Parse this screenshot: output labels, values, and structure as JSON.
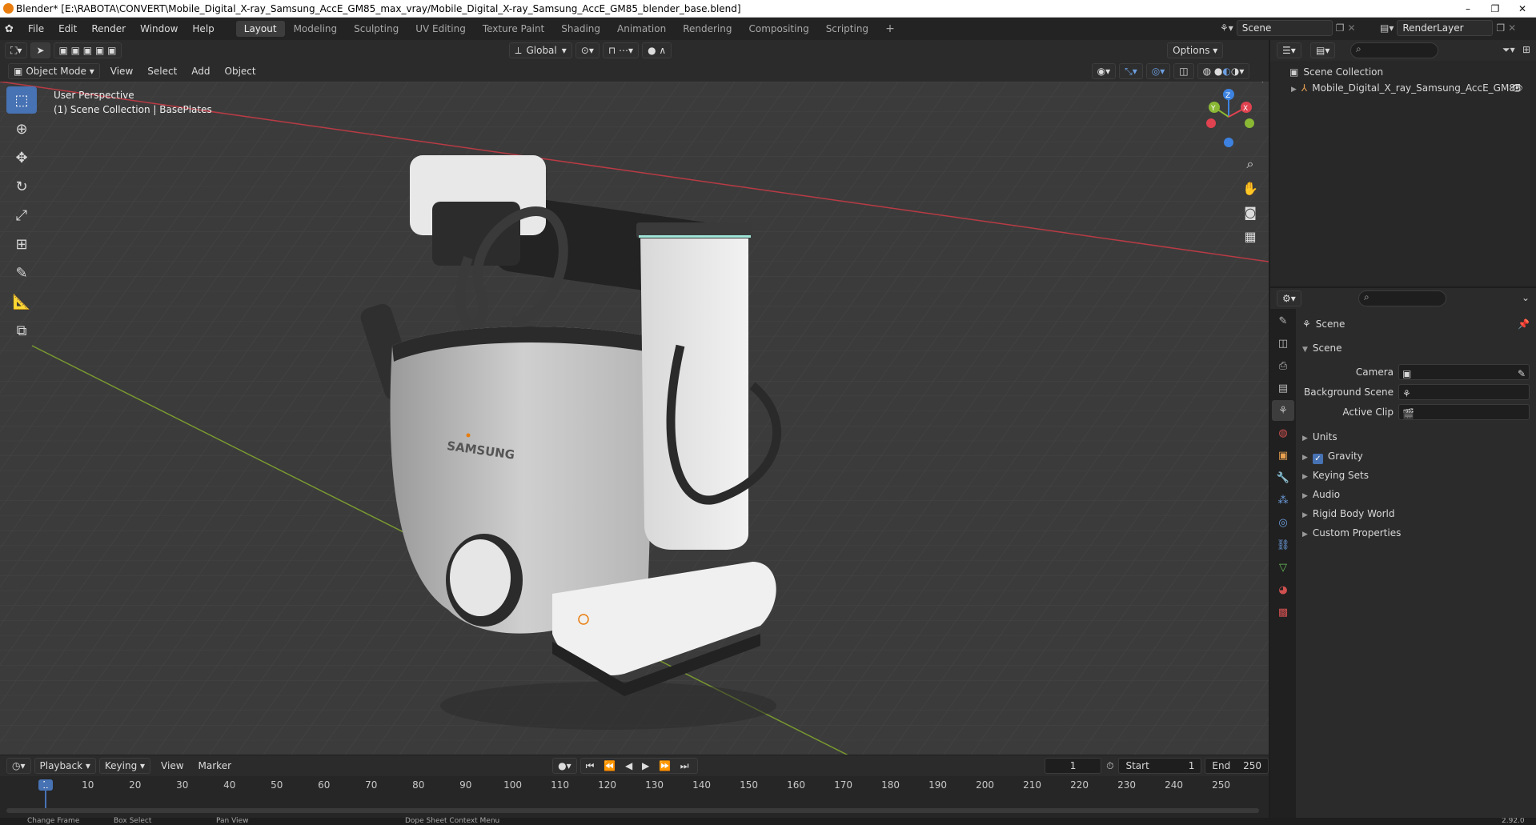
{
  "window": {
    "title": "Blender* [E:\\RABOTA\\CONVERT\\Mobile_Digital_X-ray_Samsung_AccE_GM85_max_vray/Mobile_Digital_X-ray_Samsung_AccE_GM85_blender_base.blend]",
    "buttons": [
      "–",
      "❐",
      "✕"
    ]
  },
  "menu": [
    "File",
    "Edit",
    "Render",
    "Window",
    "Help"
  ],
  "workspaces": [
    "Layout",
    "Modeling",
    "Sculpting",
    "UV Editing",
    "Texture Paint",
    "Shading",
    "Animation",
    "Rendering",
    "Compositing",
    "Scripting"
  ],
  "workspace_add": "+",
  "active_workspace": "Layout",
  "scene_name": "Scene",
  "view_layer": "RenderLayer",
  "viewport_header": {
    "transform_orientation": "Global",
    "options_label": "Options",
    "mode": "Object Mode",
    "menus": [
      "View",
      "Select",
      "Add",
      "Object"
    ]
  },
  "viewport_overlay": {
    "perspective": "User Perspective",
    "collection_info": "(1) Scene Collection | BasePlates"
  },
  "gizmo_axes": {
    "z": "Z",
    "y": "Y",
    "x": "X"
  },
  "outliner": {
    "root": "Scene Collection",
    "items": [
      "Mobile_Digital_X_ray_Samsung_AccE_GM85"
    ]
  },
  "properties": {
    "context": "Scene",
    "panel_title": "Scene",
    "fields": [
      {
        "label": "Camera",
        "value": ""
      },
      {
        "label": "Background Scene",
        "value": ""
      },
      {
        "label": "Active Clip",
        "value": ""
      }
    ],
    "sections": [
      {
        "label": "Units",
        "checkbox": false
      },
      {
        "label": "Gravity",
        "checkbox": true
      },
      {
        "label": "Keying Sets",
        "checkbox": false
      },
      {
        "label": "Audio",
        "checkbox": false
      },
      {
        "label": "Rigid Body World",
        "checkbox": false
      },
      {
        "label": "Custom Properties",
        "checkbox": false
      }
    ]
  },
  "timeline": {
    "menus": [
      "Playback",
      "Keying",
      "View",
      "Marker"
    ],
    "current_frame": "1",
    "start_label": "Start",
    "start": "1",
    "end_label": "End",
    "end": "250",
    "ruler": [
      "1",
      "10",
      "20",
      "30",
      "40",
      "50",
      "60",
      "70",
      "80",
      "90",
      "100",
      "110",
      "120",
      "130",
      "140",
      "150",
      "160",
      "170",
      "180",
      "190",
      "200",
      "210",
      "220",
      "230",
      "240",
      "250"
    ]
  },
  "status_bar": [
    "Change Frame",
    "Box Select",
    "Pan View",
    "Dope Sheet Context Menu",
    "2.92.0"
  ],
  "brand_text": "SAMSUNG",
  "colors": {
    "accent": "#4772b3",
    "x_axis": "#e0424f",
    "y_axis": "#8ab834",
    "z_axis": "#3d82e0"
  }
}
